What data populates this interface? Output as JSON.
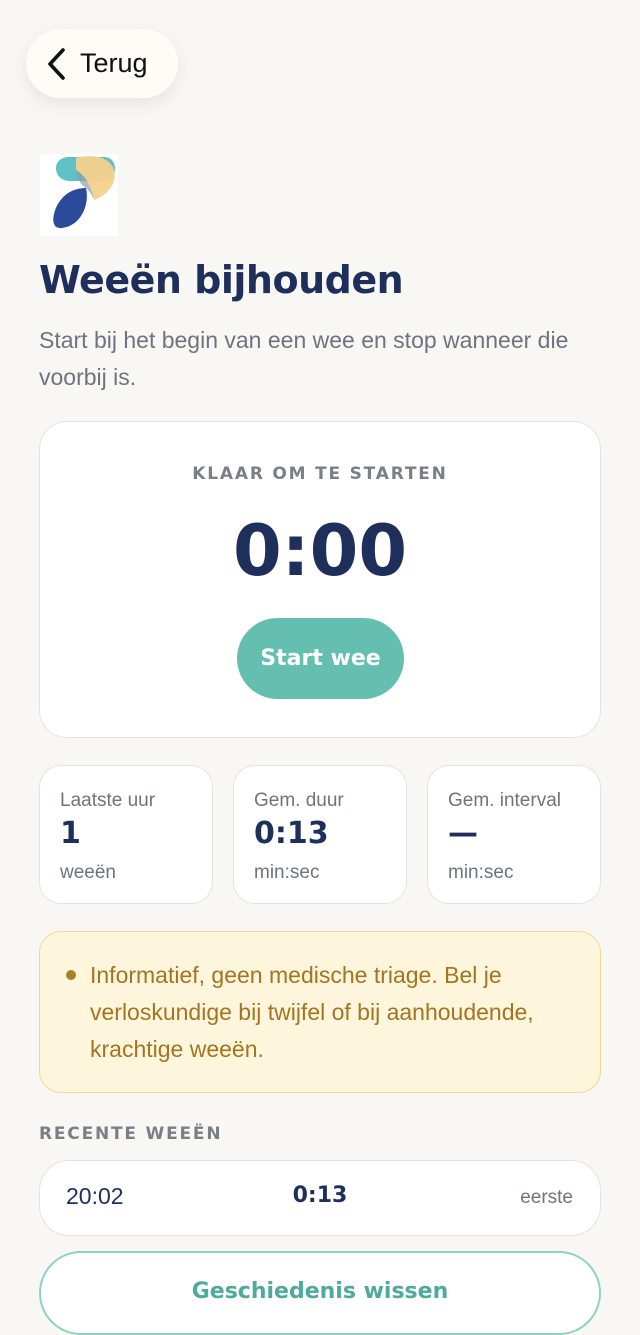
{
  "header": {
    "back_label": "Terug",
    "title": "Weeën bijhouden",
    "subtitle": "Start bij het begin van een wee en stop wanneer die voorbij is."
  },
  "timer": {
    "status": "KLAAR OM TE STARTEN",
    "value": "0:00",
    "start_label": "Start wee"
  },
  "stats": [
    {
      "label": "Laatste uur",
      "value": "1",
      "unit": "weeën"
    },
    {
      "label": "Gem. duur",
      "value": "0:13",
      "unit": "min:sec"
    },
    {
      "label": "Gem. interval",
      "value": "—",
      "unit": "min:sec"
    }
  ],
  "notice": {
    "text": "Informatief, geen medische triage. Bel je verloskundige bij twijfel of bij aanhoudende, krachtige weeën."
  },
  "recent": {
    "heading": "RECENTE WEEËN",
    "items": [
      {
        "time": "20:02",
        "duration": "0:13",
        "interval": "eerste"
      }
    ]
  },
  "actions": {
    "clear_label": "Geschiedenis wissen"
  },
  "colors": {
    "primary": "#1f2f5c",
    "accent": "#65bfb1",
    "background": "#f8f7f4",
    "notice_bg": "#fdf6dc",
    "notice_text": "#a57420"
  },
  "icons": {
    "back": "chevron-left-icon",
    "logo": "app-logo"
  }
}
